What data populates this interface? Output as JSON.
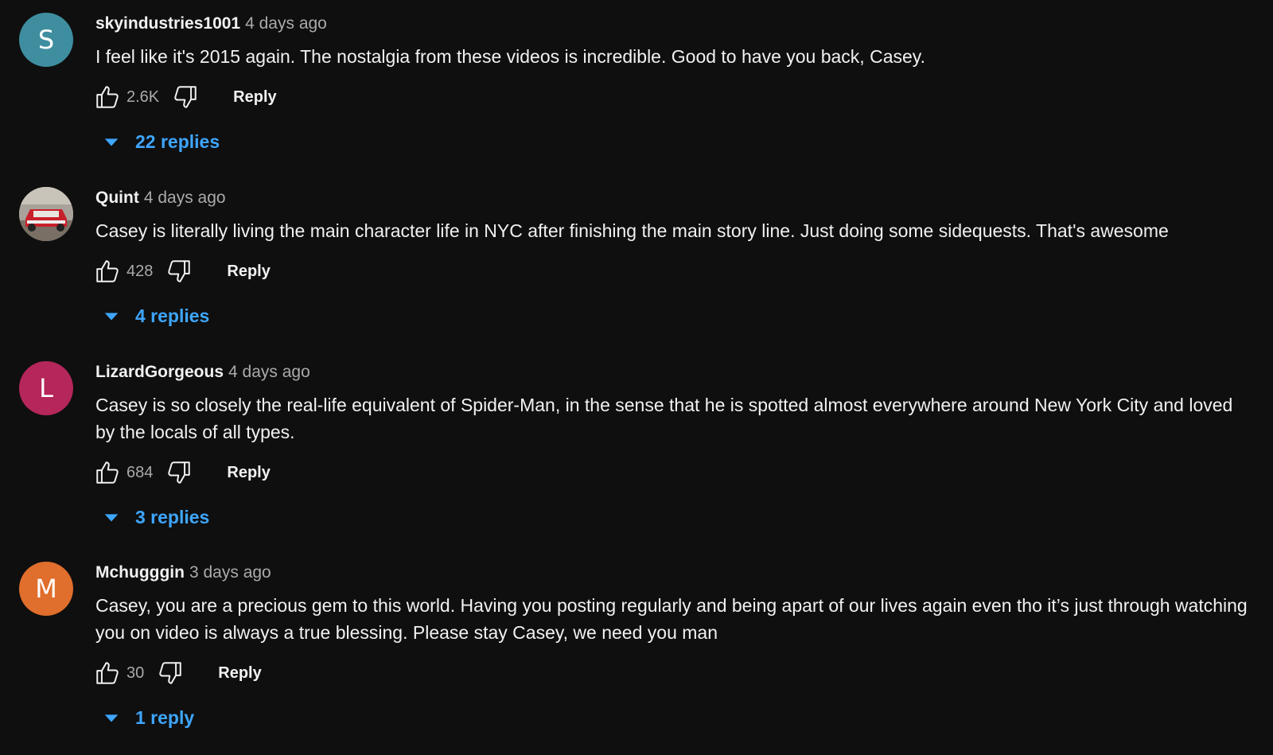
{
  "comments": [
    {
      "author": "skyindustries1001",
      "time": "4 days ago",
      "avatar_letter": "S",
      "avatar_color": "#3e8ea0",
      "text": "I feel like it's 2015 again. The nostalgia from these videos is incredible. Good to have you back, Casey.",
      "likes": "2.6K",
      "reply_label": "Reply",
      "replies_label": "22 replies"
    },
    {
      "author": "Quint",
      "time": "4 days ago",
      "avatar_letter": "",
      "avatar_color": "#8a8a8a",
      "text": "Casey is literally living the main character life in NYC after finishing the main story line. Just doing some sidequests. That's awesome",
      "likes": "428",
      "reply_label": "Reply",
      "replies_label": "4 replies"
    },
    {
      "author": "LizardGorgeous",
      "time": "4 days ago",
      "avatar_letter": "L",
      "avatar_color": "#b5265a",
      "text": "Casey is so closely the real-life equivalent of Spider-Man, in the sense that he is spotted almost everywhere around New York City and loved by the locals of all types.",
      "likes": "684",
      "reply_label": "Reply",
      "replies_label": "3 replies"
    },
    {
      "author": "Mchugggin",
      "time": "3 days ago",
      "avatar_letter": "M",
      "avatar_color": "#e06e2c",
      "text": "Casey, you are a precious gem to this world. Having you posting regularly and being apart of our lives again even tho it’s just through watching you on video is always a true blessing. Please stay Casey, we need you man",
      "likes": "30",
      "reply_label": "Reply",
      "replies_label": "1 reply"
    }
  ],
  "icons": {
    "like": "thumb-up-icon",
    "dislike": "thumb-down-icon",
    "expand": "caret-down-icon"
  },
  "colors": {
    "background": "#0f0f0f",
    "link_blue": "#3ea6ff",
    "secondary_text": "#aaaaaa"
  }
}
